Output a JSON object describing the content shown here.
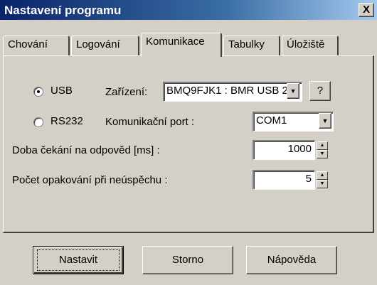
{
  "window": {
    "title": "Nastavení programu",
    "close_label": "X"
  },
  "tabs": [
    {
      "label": "Chování",
      "active": false
    },
    {
      "label": "Logování",
      "active": false
    },
    {
      "label": "Komunikace",
      "active": true
    },
    {
      "label": "Tabulky",
      "active": false
    },
    {
      "label": "Úložiště",
      "active": false
    }
  ],
  "comm": {
    "usb_label": "USB",
    "usb_selected": true,
    "device_label": "Zařízení:",
    "device_value": "BMQ9FJK1 : BMR USB 2.",
    "help_label": "?",
    "rs232_label": "RS232",
    "rs232_selected": false,
    "port_label": "Komunikační port :",
    "port_value": "COM1",
    "timeout_label": "Doba čekání na odpověd [ms] :",
    "timeout_value": "1000",
    "retries_label": "Počet opakování při neúspěchu :",
    "retries_value": "5"
  },
  "buttons": {
    "set_label": "Nastavit",
    "cancel_label": "Storno",
    "help_label": "Nápověda"
  }
}
